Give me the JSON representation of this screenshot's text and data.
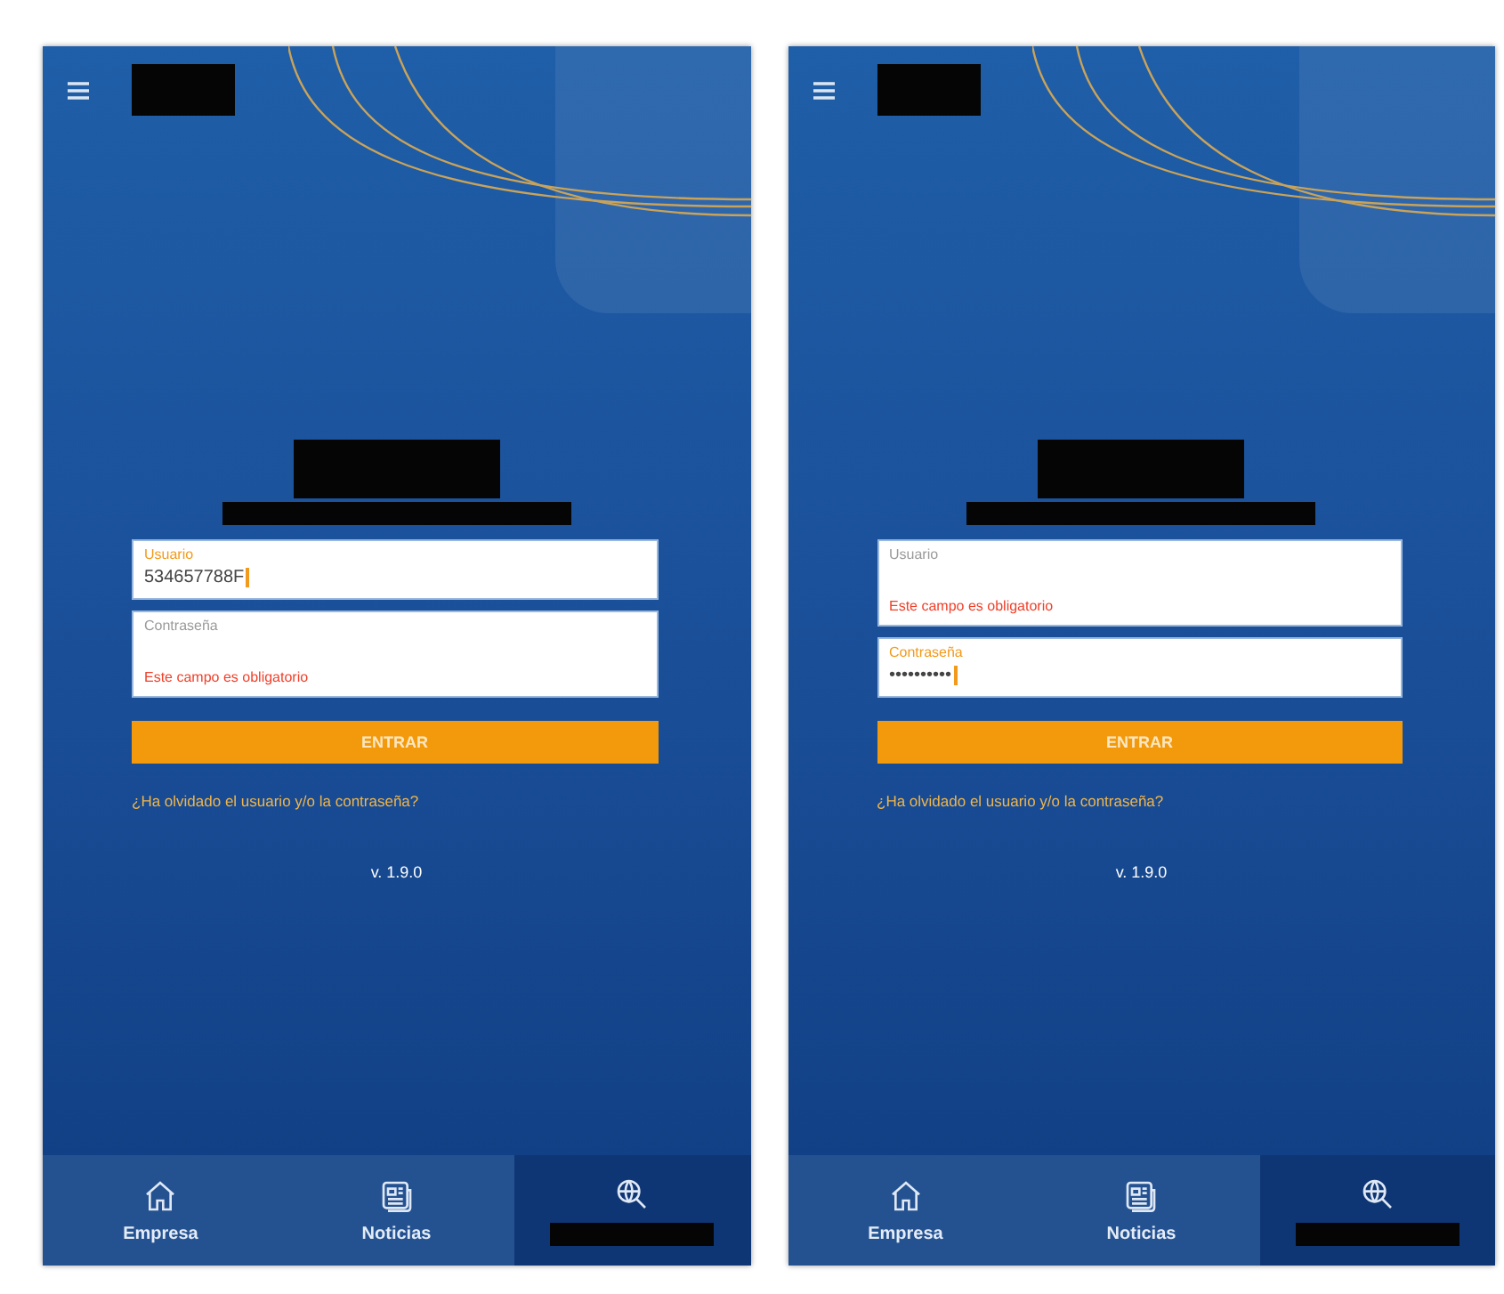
{
  "screens": [
    {
      "fields": [
        {
          "label": "Usuario",
          "value": "534657788F",
          "focused": true
        },
        {
          "label": "Contraseña",
          "focused": false,
          "error": "Este campo es obligatorio"
        }
      ],
      "button": "ENTRAR",
      "link": "¿Ha olvidado el usuario y/o la contraseña?",
      "version": "v. 1.9.0",
      "nav": [
        {
          "kind": "home",
          "label": "Empresa",
          "selected": false
        },
        {
          "kind": "news",
          "label": "Noticias",
          "selected": false
        },
        {
          "kind": "search",
          "selected": true
        }
      ]
    },
    {
      "fields": [
        {
          "label": "Usuario",
          "focused": false,
          "error": "Este campo es obligatorio"
        },
        {
          "label": "Contraseña",
          "value": "••••••••••",
          "focused": true
        }
      ],
      "button": "ENTRAR",
      "link": "¿Ha olvidado el usuario y/o la contraseña?",
      "version": "v. 1.9.0",
      "nav": [
        {
          "kind": "home",
          "label": "Empresa",
          "selected": false
        },
        {
          "kind": "news",
          "label": "Noticias",
          "selected": false
        },
        {
          "kind": "search",
          "selected": true
        }
      ]
    }
  ]
}
